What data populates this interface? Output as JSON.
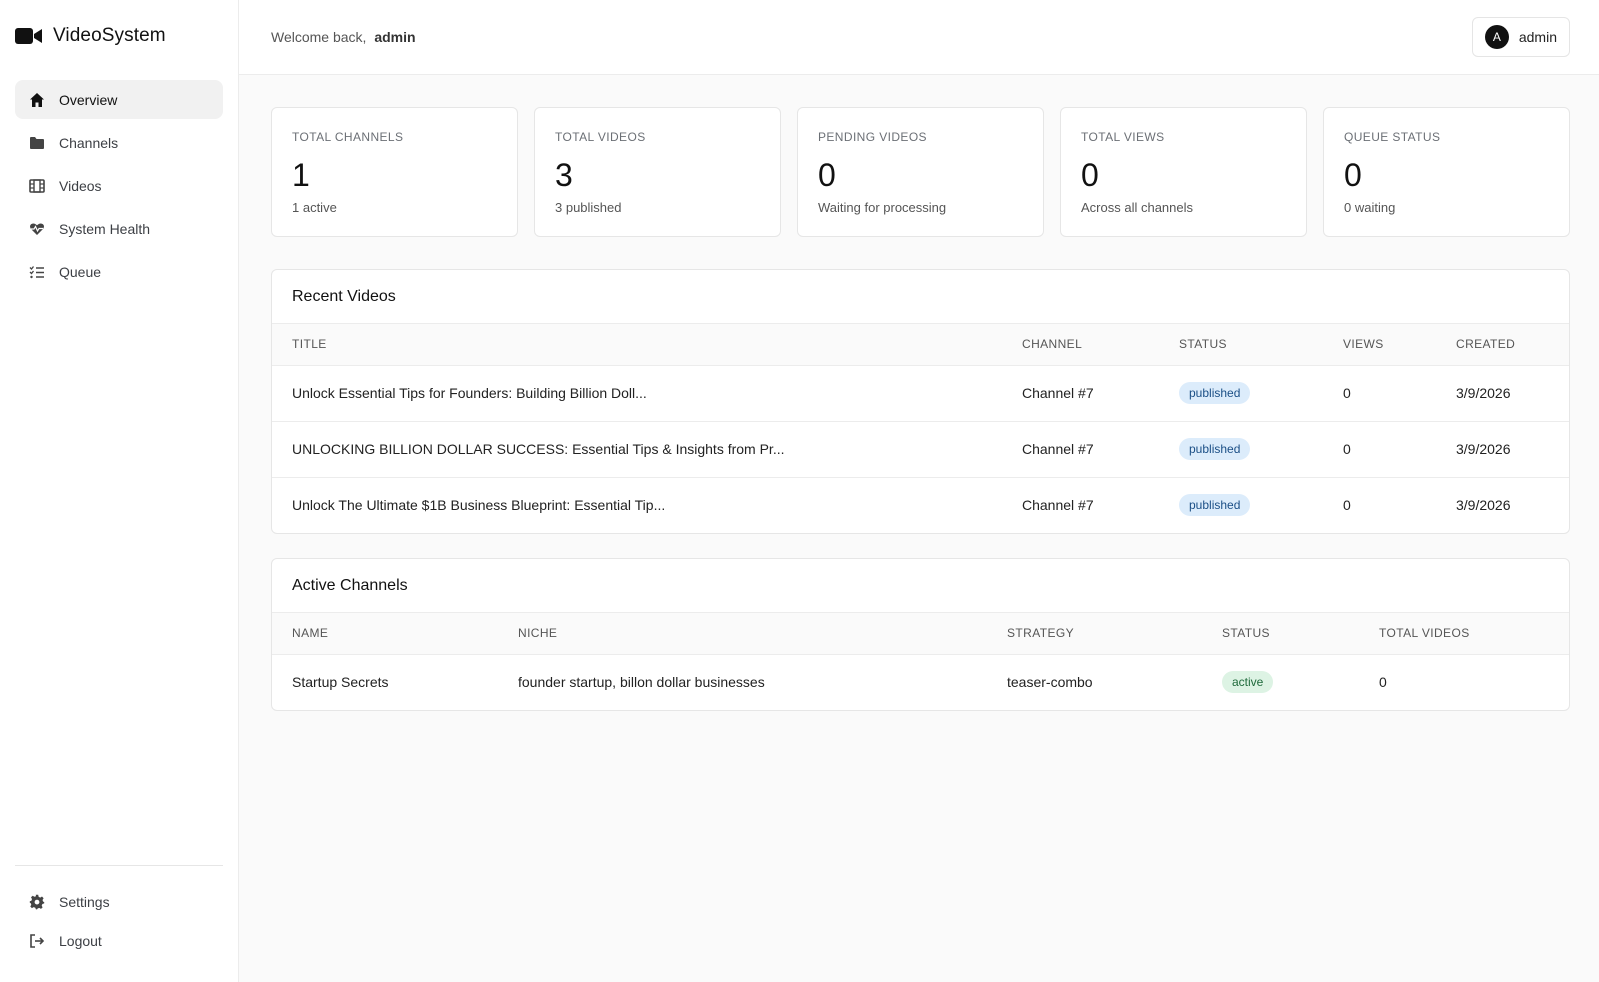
{
  "app": {
    "name": "VideoSystem"
  },
  "sidebar": {
    "items": [
      {
        "label": "Overview",
        "icon": "home-icon",
        "active": true
      },
      {
        "label": "Channels",
        "icon": "folder-icon"
      },
      {
        "label": "Videos",
        "icon": "film-icon"
      },
      {
        "label": "System Health",
        "icon": "heart-pulse-icon"
      },
      {
        "label": "Queue",
        "icon": "list-check-icon"
      }
    ],
    "bottom": [
      {
        "label": "Settings",
        "icon": "gear-icon"
      },
      {
        "label": "Logout",
        "icon": "logout-icon"
      }
    ]
  },
  "header": {
    "welcome": "Welcome back,",
    "username": "admin",
    "avatar_initial": "A",
    "user_label": "admin"
  },
  "stats": [
    {
      "label": "TOTAL CHANNELS",
      "value": "1",
      "sub": "1 active"
    },
    {
      "label": "TOTAL VIDEOS",
      "value": "3",
      "sub": "3 published"
    },
    {
      "label": "PENDING VIDEOS",
      "value": "0",
      "sub": "Waiting for processing"
    },
    {
      "label": "TOTAL VIEWS",
      "value": "0",
      "sub": "Across all channels"
    },
    {
      "label": "QUEUE STATUS",
      "value": "0",
      "sub": "0 waiting"
    }
  ],
  "recent_videos": {
    "title": "Recent Videos",
    "columns": [
      "TITLE",
      "CHANNEL",
      "STATUS",
      "VIEWS",
      "CREATED"
    ],
    "rows": [
      {
        "title": "Unlock Essential Tips for Founders: Building Billion Doll...",
        "channel": "Channel #7",
        "status": "published",
        "views": "0",
        "created": "3/9/2026"
      },
      {
        "title": "UNLOCKING BILLION DOLLAR SUCCESS: Essential Tips & Insights from Pr...",
        "channel": "Channel #7",
        "status": "published",
        "views": "0",
        "created": "3/9/2026"
      },
      {
        "title": "Unlock The Ultimate $1B Business Blueprint: Essential Tip...",
        "channel": "Channel #7",
        "status": "published",
        "views": "0",
        "created": "3/9/2026"
      }
    ]
  },
  "active_channels": {
    "title": "Active Channels",
    "columns": [
      "NAME",
      "NICHE",
      "STRATEGY",
      "STATUS",
      "TOTAL VIDEOS"
    ],
    "rows": [
      {
        "name": "Startup Secrets",
        "niche": "founder startup, billon dollar businesses",
        "strategy": "teaser-combo",
        "status": "active",
        "total_videos": "0"
      }
    ]
  },
  "colors": {
    "published_bg": "#dcecfb",
    "active_bg": "#ddf3e4"
  }
}
